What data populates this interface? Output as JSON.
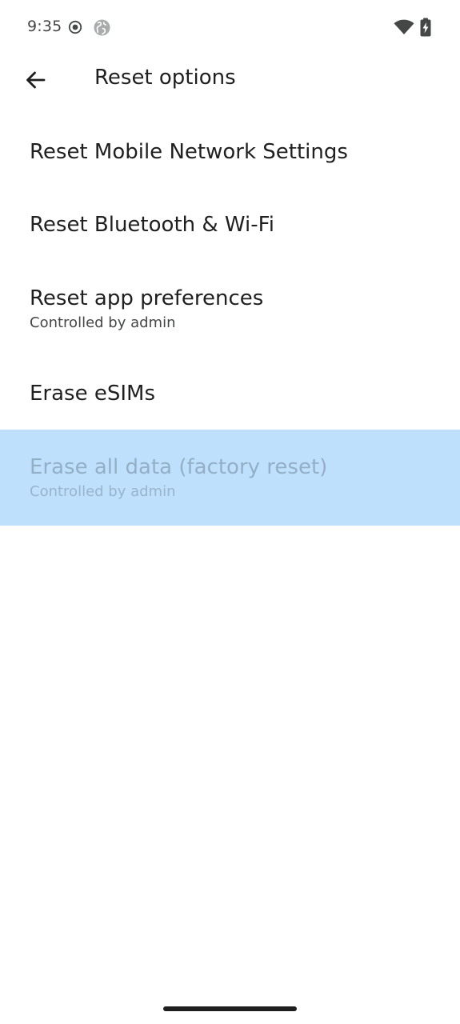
{
  "status_bar": {
    "time": "9:35",
    "icons": [
      "record-icon",
      "globe-icon",
      "wifi-icon",
      "battery-charging-icon"
    ]
  },
  "app_bar": {
    "back_icon": "arrow-back-icon",
    "title": "Reset options"
  },
  "items": [
    {
      "title": "Reset Mobile Network Settings",
      "summary": ""
    },
    {
      "title": "Reset Bluetooth & Wi-Fi",
      "summary": ""
    },
    {
      "title": "Reset app preferences",
      "summary": "Controlled by admin"
    },
    {
      "title": "Erase eSIMs",
      "summary": ""
    },
    {
      "title": "Erase all data (factory reset)",
      "summary": "Controlled by admin",
      "disabled": true
    }
  ],
  "colors": {
    "highlight": "#bfe0fd",
    "text_primary": "#1f1f1f",
    "text_secondary": "#444746"
  }
}
